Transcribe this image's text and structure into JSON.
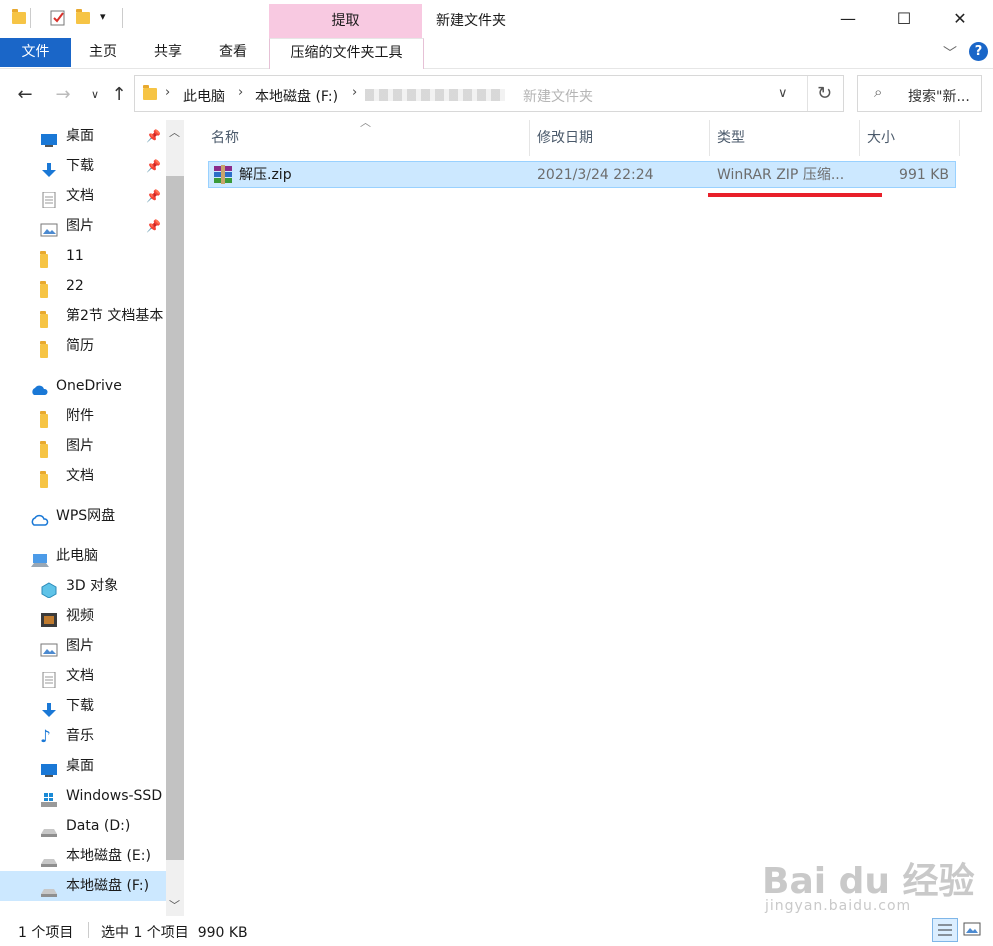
{
  "title_bar": {
    "context_group": "提取",
    "window_title": "新建文件夹",
    "controls": [
      "—",
      "☐",
      "✕"
    ]
  },
  "ribbon": {
    "tabs": [
      "文件",
      "主页",
      "共享",
      "查看",
      "压缩的文件夹工具"
    ],
    "help": "?"
  },
  "address": {
    "crumbs": [
      "此电脑",
      "本地磁盘 (F:)",
      "新建文件夹"
    ],
    "search_placeholder": "搜索\"新..."
  },
  "sidebar": {
    "quick_access": [
      {
        "label": "桌面",
        "icon": "desktop-icon",
        "pinned": true
      },
      {
        "label": "下载",
        "icon": "download-icon",
        "pinned": true
      },
      {
        "label": "文档",
        "icon": "document-icon",
        "pinned": true
      },
      {
        "label": "图片",
        "icon": "picture-icon",
        "pinned": true
      },
      {
        "label": "11",
        "icon": "folder-icon",
        "pinned": false
      },
      {
        "label": "22",
        "icon": "folder-icon",
        "pinned": false
      },
      {
        "label": "第2节 文档基本",
        "icon": "folder-icon",
        "pinned": false
      },
      {
        "label": "简历",
        "icon": "folder-icon",
        "pinned": false
      }
    ],
    "onedrive": {
      "label": "OneDrive",
      "items": [
        "附件",
        "图片",
        "文档"
      ]
    },
    "wps": {
      "label": "WPS网盘"
    },
    "this_pc": {
      "label": "此电脑",
      "items": [
        {
          "label": "3D 对象",
          "icon": "3d-objects-icon"
        },
        {
          "label": "视频",
          "icon": "video-icon"
        },
        {
          "label": "图片",
          "icon": "picture-icon"
        },
        {
          "label": "文档",
          "icon": "document-icon"
        },
        {
          "label": "下载",
          "icon": "download-icon"
        },
        {
          "label": "音乐",
          "icon": "music-icon"
        },
        {
          "label": "桌面",
          "icon": "desktop-icon"
        },
        {
          "label": "Windows-SSD",
          "icon": "windows-drive-icon"
        },
        {
          "label": "Data (D:)",
          "icon": "drive-icon"
        },
        {
          "label": "本地磁盘 (E:)",
          "icon": "drive-icon"
        },
        {
          "label": "本地磁盘 (F:)",
          "icon": "drive-icon"
        }
      ]
    }
  },
  "file_list": {
    "columns": [
      "名称",
      "修改日期",
      "类型",
      "大小"
    ],
    "rows": [
      {
        "name": "解压.zip",
        "modified": "2021/3/24 22:24",
        "type": "WinRAR ZIP 压缩...",
        "size": "991 KB"
      }
    ]
  },
  "status": {
    "count": "1 个项目",
    "selected": "选中 1 个项目  990 KB"
  },
  "watermark": {
    "brand": "Bai du 经验",
    "url": "jingyan.baidu.com"
  },
  "colors": {
    "accent": "#1a66c8",
    "selection": "#cce8ff",
    "highlight_line": "#e8202a",
    "context_tab": "#f8c9e1"
  }
}
